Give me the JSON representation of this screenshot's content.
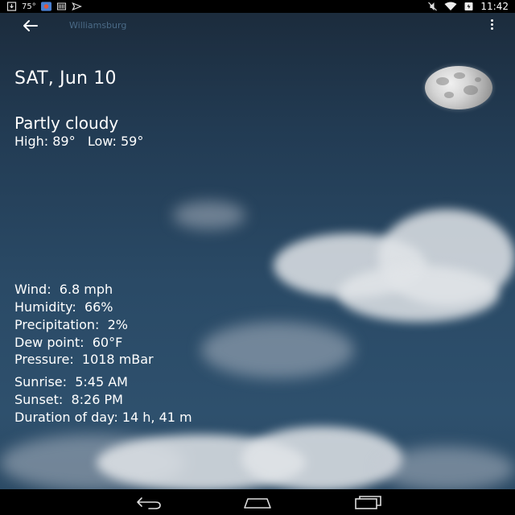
{
  "status_bar": {
    "temperature": "75°",
    "time": "11:42"
  },
  "app_bar": {
    "location": "Williamsburg"
  },
  "forecast": {
    "date": "SAT, Jun 10",
    "condition": "Partly cloudy",
    "high_low": "High: 89°   Low: 59°"
  },
  "details": {
    "wind": "Wind:  6.8 mph",
    "humidity": "Humidity:  66%",
    "precipitation": "Precipitation:  2%",
    "dew_point": "Dew point:  60°F",
    "pressure": "Pressure:  1018 mBar",
    "sunrise": "Sunrise:  5:45 AM",
    "sunset": "Sunset:  8:26 PM",
    "duration": "Duration of day: 14 h, 41 m"
  },
  "icons": {
    "back": "arrow-left-icon",
    "overflow": "more-vert-icon",
    "moon": "moon-icon",
    "nav_back": "nav-back-icon",
    "nav_home": "nav-home-icon",
    "nav_recents": "nav-recents-icon"
  },
  "colors": {
    "status_bar_bg": "#000000",
    "sky_top": "#1b2a3a",
    "sky_bottom": "#2e506d",
    "text": "#ffffff",
    "location_text": "#4a6a86"
  }
}
